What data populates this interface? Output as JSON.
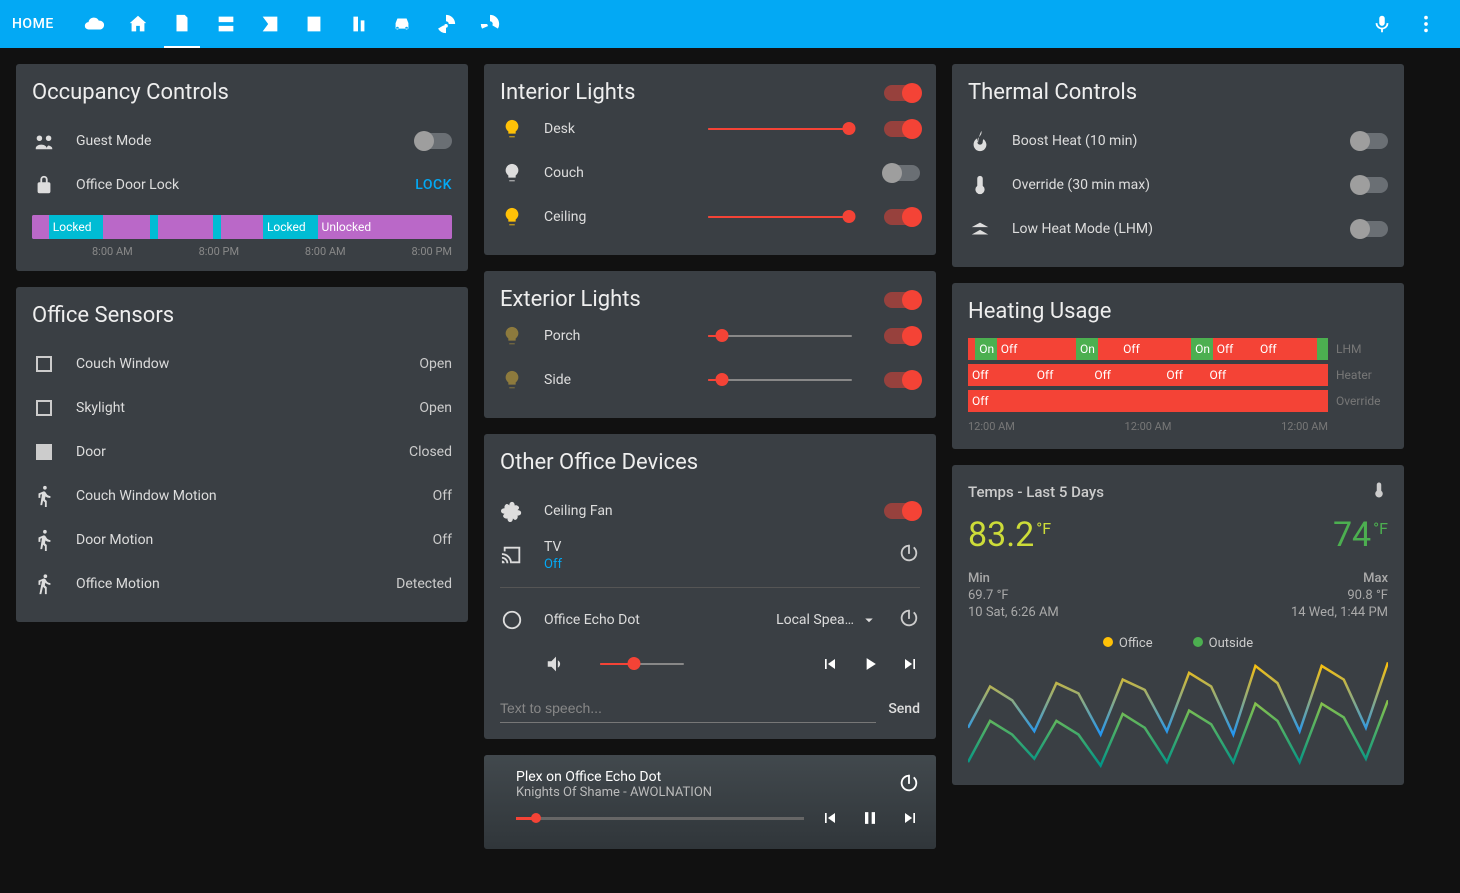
{
  "topbar": {
    "home": "HOME"
  },
  "occupancy": {
    "title": "Occupancy Controls",
    "guest_mode": "Guest Mode",
    "door_lock": "Office Door Lock",
    "door_lock_state": "LOCK",
    "timeline": {
      "labels": [
        "8:00 AM",
        "8:00 PM",
        "8:00 AM",
        "8:00 PM"
      ],
      "seg_locked": "Locked",
      "seg_unlocked": "Unlocked"
    }
  },
  "sensors": {
    "title": "Office Sensors",
    "items": [
      {
        "label": "Couch Window",
        "state": "Open",
        "icon": "box-open"
      },
      {
        "label": "Skylight",
        "state": "Open",
        "icon": "box-open"
      },
      {
        "label": "Door",
        "state": "Closed",
        "icon": "box-closed"
      },
      {
        "label": "Couch Window Motion",
        "state": "Off",
        "icon": "motion"
      },
      {
        "label": "Door Motion",
        "state": "Off",
        "icon": "motion"
      },
      {
        "label": "Office Motion",
        "state": "Detected",
        "icon": "run"
      }
    ]
  },
  "interior": {
    "title": "Interior Lights",
    "items": [
      {
        "label": "Desk",
        "on": true,
        "level": 98
      },
      {
        "label": "Couch",
        "on": false,
        "level": 0
      },
      {
        "label": "Ceiling",
        "on": true,
        "level": 98
      }
    ]
  },
  "exterior": {
    "title": "Exterior Lights",
    "items": [
      {
        "label": "Porch",
        "on": true,
        "level": 10,
        "dim": true
      },
      {
        "label": "Side",
        "on": true,
        "level": 10,
        "dim": true
      }
    ]
  },
  "other": {
    "title": "Other Office Devices",
    "fan": "Ceiling Fan",
    "tv": "TV",
    "tv_state": "Off",
    "echo": "Office Echo Dot",
    "echo_source": "Local Spea…",
    "tts_placeholder": "Text to speech...",
    "send": "Send"
  },
  "media": {
    "title": "Plex on Office Echo Dot",
    "subtitle": "Knights Of Shame - AWOLNATION",
    "progress": 7
  },
  "thermal": {
    "title": "Thermal Controls",
    "boost": "Boost Heat (10 min)",
    "override": "Override (30 min max)",
    "lhm": "Low Heat Mode (LHM)"
  },
  "heating": {
    "title": "Heating Usage",
    "rows": [
      {
        "label": "LHM"
      },
      {
        "label": "Heater"
      },
      {
        "label": "Override"
      }
    ],
    "seg_on": "On",
    "seg_off": "Off",
    "times": [
      "12:00 AM",
      "12:00 AM",
      "12:00 AM"
    ]
  },
  "temps": {
    "title": "Temps - Last 5 Days",
    "office": "83.2",
    "office_unit": "°F",
    "outside": "74",
    "outside_unit": "°F",
    "min_label": "Min",
    "min_val": "69.7 °F",
    "min_time": "10 Sat, 6:26 AM",
    "max_label": "Max",
    "max_val": "90.8 °F",
    "max_time": "14 Wed, 1:44 PM",
    "legend_office": "Office",
    "legend_outside": "Outside"
  },
  "chart_data": {
    "type": "line",
    "title": "Temps - Last 5 Days",
    "xlabel": "",
    "ylabel": "°F",
    "ylim": [
      60,
      92
    ],
    "x": [
      0,
      1,
      2,
      3,
      4,
      5,
      6,
      7,
      8,
      9,
      10,
      11,
      12,
      13,
      14,
      15,
      16,
      17,
      18,
      19
    ],
    "series": [
      {
        "name": "Office",
        "color": "#ffc107",
        "values": [
          72,
          84,
          80,
          71,
          85,
          82,
          70,
          86,
          83,
          71,
          88,
          84,
          70,
          90,
          85,
          71,
          90,
          86,
          72,
          91
        ]
      },
      {
        "name": "Outside",
        "color": "#4caf50",
        "values": [
          62,
          74,
          70,
          63,
          74,
          70,
          61,
          76,
          72,
          62,
          77,
          73,
          62,
          79,
          74,
          62,
          79,
          75,
          63,
          80
        ]
      }
    ]
  }
}
